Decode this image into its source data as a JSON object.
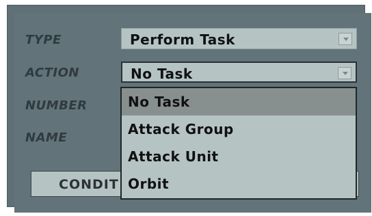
{
  "labels": {
    "type": "TYPE",
    "action": "ACTION",
    "number": "NUMBER",
    "name": "NAME"
  },
  "fields": {
    "type_value": "Perform Task",
    "action_value": "No Task"
  },
  "conditions_button": {
    "label": "CONDIT",
    "tail": "."
  },
  "dropdown": {
    "options": [
      "No Task",
      "Attack Group",
      "Attack Unit",
      "Orbit"
    ],
    "selected": "No Task"
  },
  "icons": {
    "dropdown_arrow": "chevron-down-icon"
  }
}
